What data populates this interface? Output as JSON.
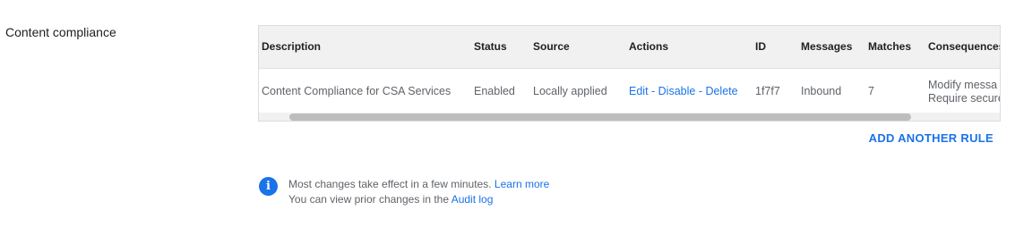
{
  "section": {
    "title": "Content compliance"
  },
  "table": {
    "headers": [
      "Description",
      "Status",
      "Source",
      "Actions",
      "ID",
      "Messages",
      "Matches",
      "Consequences"
    ],
    "rows": [
      {
        "description": "Content Compliance for CSA Services",
        "status": "Enabled",
        "source": "Locally applied",
        "actions": {
          "edit": "Edit",
          "sep1": " - ",
          "disable": "Disable",
          "sep2": " - ",
          "delete": "Delete"
        },
        "id": "1f7f7",
        "messages": "Inbound",
        "matches": "7",
        "consequences": [
          "Modify messa",
          "Require secure"
        ]
      }
    ]
  },
  "add_rule_label": "ADD ANOTHER RULE",
  "info": {
    "line1_text": "Most changes take effect in a few minutes.",
    "line1_link": "Learn more",
    "line2_text": "You can view prior changes in the",
    "line2_link": "Audit log"
  },
  "colors": {
    "accent": "#1a73e8",
    "header_bg": "#f1f1f1",
    "muted_text": "#5f6368"
  }
}
